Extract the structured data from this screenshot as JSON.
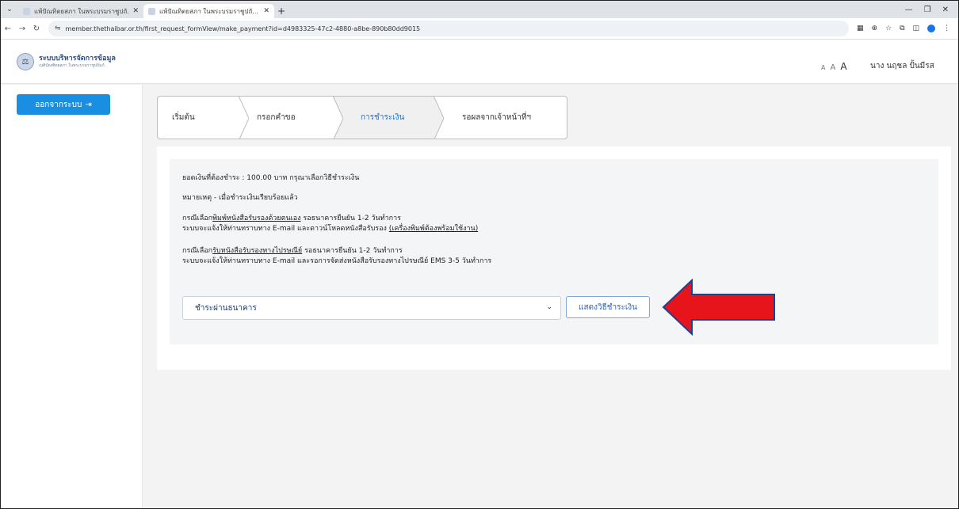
{
  "browser": {
    "tabs": [
      {
        "title": "แพ้ปัณทิตยสภา ในพระบรมราชูปถั..."
      },
      {
        "title": "แพ้ปัณทิตยสภา ในพระบรมราชูปถั..."
      }
    ],
    "url": "member.thethaibar.or.th/first_request_formView/make_payment?id=d4983325-47c2-4880-a8be-890b80dd9015"
  },
  "header": {
    "logo_main": "ระบบบริหารจัดการข้อมูล",
    "logo_sub": "เนติบัณฑิตยสภา ในพระบรมราชูปถัมภ์",
    "font_small": "A",
    "font_medium": "A",
    "font_large": "A",
    "user_name": "นาง นฤชล ปั้นมีรส"
  },
  "sidebar": {
    "logout_label": "ออกจากระบบ",
    "logout_icon": "sign-out-icon"
  },
  "steps": [
    {
      "label": "เริ่มต้น",
      "active": false
    },
    {
      "label": "กรอกคำขอ",
      "active": false
    },
    {
      "label": "การชำระเงิน",
      "active": true
    },
    {
      "label": "รอผลจากเจ้าหน้าที่ฯ",
      "active": false
    }
  ],
  "payment": {
    "amount_line": "ยอดเงินที่ต้องชำระ : 100.00 บาท กรุณาเลือกวิธีชำระเงิน",
    "note_line": "หมายเหตุ - เมื่อชำระเงินเรียบร้อยแล้ว",
    "case1_prefix": "กรณีเลือก",
    "case1_link": "พิมพ์หนังสือรับรองด้วยตนเอง",
    "case1_suffix": " รอธนาคารยืนยัน 1-2 วันทำการ",
    "case1_line2_prefix": "ระบบจะแจ้งให้ท่านทราบทาง E-mail และดาวน์โหลดหนังสือรับรอง ",
    "case1_line2_link": "(เครื่องพิมพ์ต้องพร้อมใช้งาน)",
    "case2_prefix": "กรณีเลือก",
    "case2_link": "รับหนังสือรับรองทางไปรษณีย์",
    "case2_suffix": " รอธนาคารยืนยัน 1-2 วันทำการ",
    "case2_line2": "ระบบจะแจ้งให้ท่านทราบทาง E-mail และรอการจัดส่งหนังสือรับรองทางไปรษณีย์ EMS 3-5 วันทำการ",
    "method_selected": "ชำระผ่านธนาคาร",
    "show_button": "แสดงวิธีชำระเงิน"
  },
  "colors": {
    "primary": "#1a8ee0",
    "arrow": "#e8141b",
    "arrow_outline": "#1f3f8f"
  }
}
